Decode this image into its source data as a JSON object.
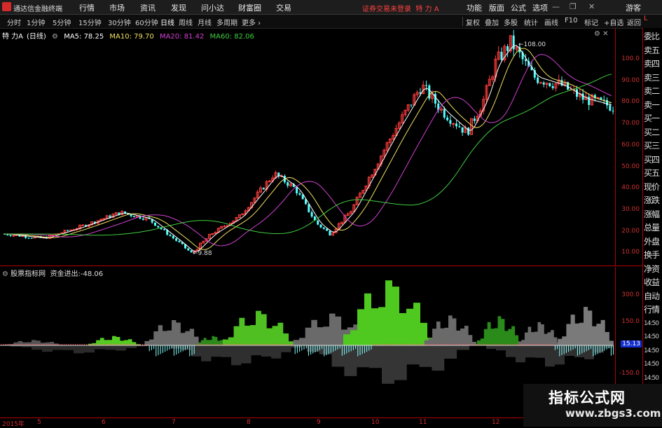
{
  "app": {
    "title": "通达信金融终端",
    "menu": [
      "行情",
      "市场",
      "资讯",
      "发现",
      "问小达",
      "财富圈",
      "交易"
    ],
    "login_status": "证券交易未登录",
    "stock_name": "特 力 A",
    "right_menu": [
      "功能",
      "版面",
      "公式",
      "选项"
    ],
    "guest": "游客",
    "window_buttons": [
      "minimize-icon",
      "restore-icon",
      "close-icon"
    ]
  },
  "periods": [
    "分时",
    "1分钟",
    "5分钟",
    "15分钟",
    "30分钟",
    "60分钟",
    "日线",
    "周线",
    "月线",
    "多周期",
    "更多"
  ],
  "active_period": "日线",
  "toolbar_right": [
    "复权",
    "叠加",
    "多股",
    "统计",
    "画线",
    "F10",
    "标记",
    "+自选",
    "返回"
  ],
  "legend": {
    "stock": "特 力A",
    "period_tag": "(日线)",
    "ma": [
      {
        "label": "MA5: 78.25",
        "color": "#ffffff"
      },
      {
        "label": "MA10: 79.70",
        "color": "#f0e060"
      },
      {
        "label": "MA20: 81.42",
        "color": "#d040d0"
      },
      {
        "label": "MA60: 82.06",
        "color": "#40d040"
      }
    ]
  },
  "price_axis": [
    "100.0",
    "90.00",
    "80.00",
    "70.00",
    "60.00",
    "50.00",
    "40.00",
    "30.00",
    "20.00",
    "10.00"
  ],
  "annotations": {
    "high": "108.00",
    "low": "9.88"
  },
  "indicator": {
    "name": "股票指标网",
    "title": "资金进出:",
    "value": "-48.06",
    "axis": [
      "300.0",
      "150.0",
      "-150.0"
    ],
    "current": "15.13"
  },
  "right_panel": [
    "委比",
    "卖五",
    "卖四",
    "卖三",
    "卖二",
    "卖一",
    "买一",
    "买二",
    "买三",
    "买四",
    "买五",
    "现价",
    "涨跌",
    "涨幅",
    "总量",
    "外盘",
    "换手",
    "净资",
    "收益",
    "自动",
    "行情",
    "14:50",
    "14:50",
    "14:50",
    "14:50",
    "14:50",
    "14:50",
    "14:50"
  ],
  "time_axis": [
    "2015年",
    "5",
    "6",
    "7",
    "8",
    "9",
    "10",
    "11",
    "12"
  ],
  "watermark": {
    "line1": "指标公式网",
    "line2": "www.zbgs3.com"
  },
  "colors": {
    "up": "#ff3c3c",
    "down": "#54ffff",
    "ma5": "#ffffff",
    "ma10": "#f0e060",
    "ma20": "#d040d0",
    "ma60": "#40d040",
    "axis": "#b00000"
  }
}
